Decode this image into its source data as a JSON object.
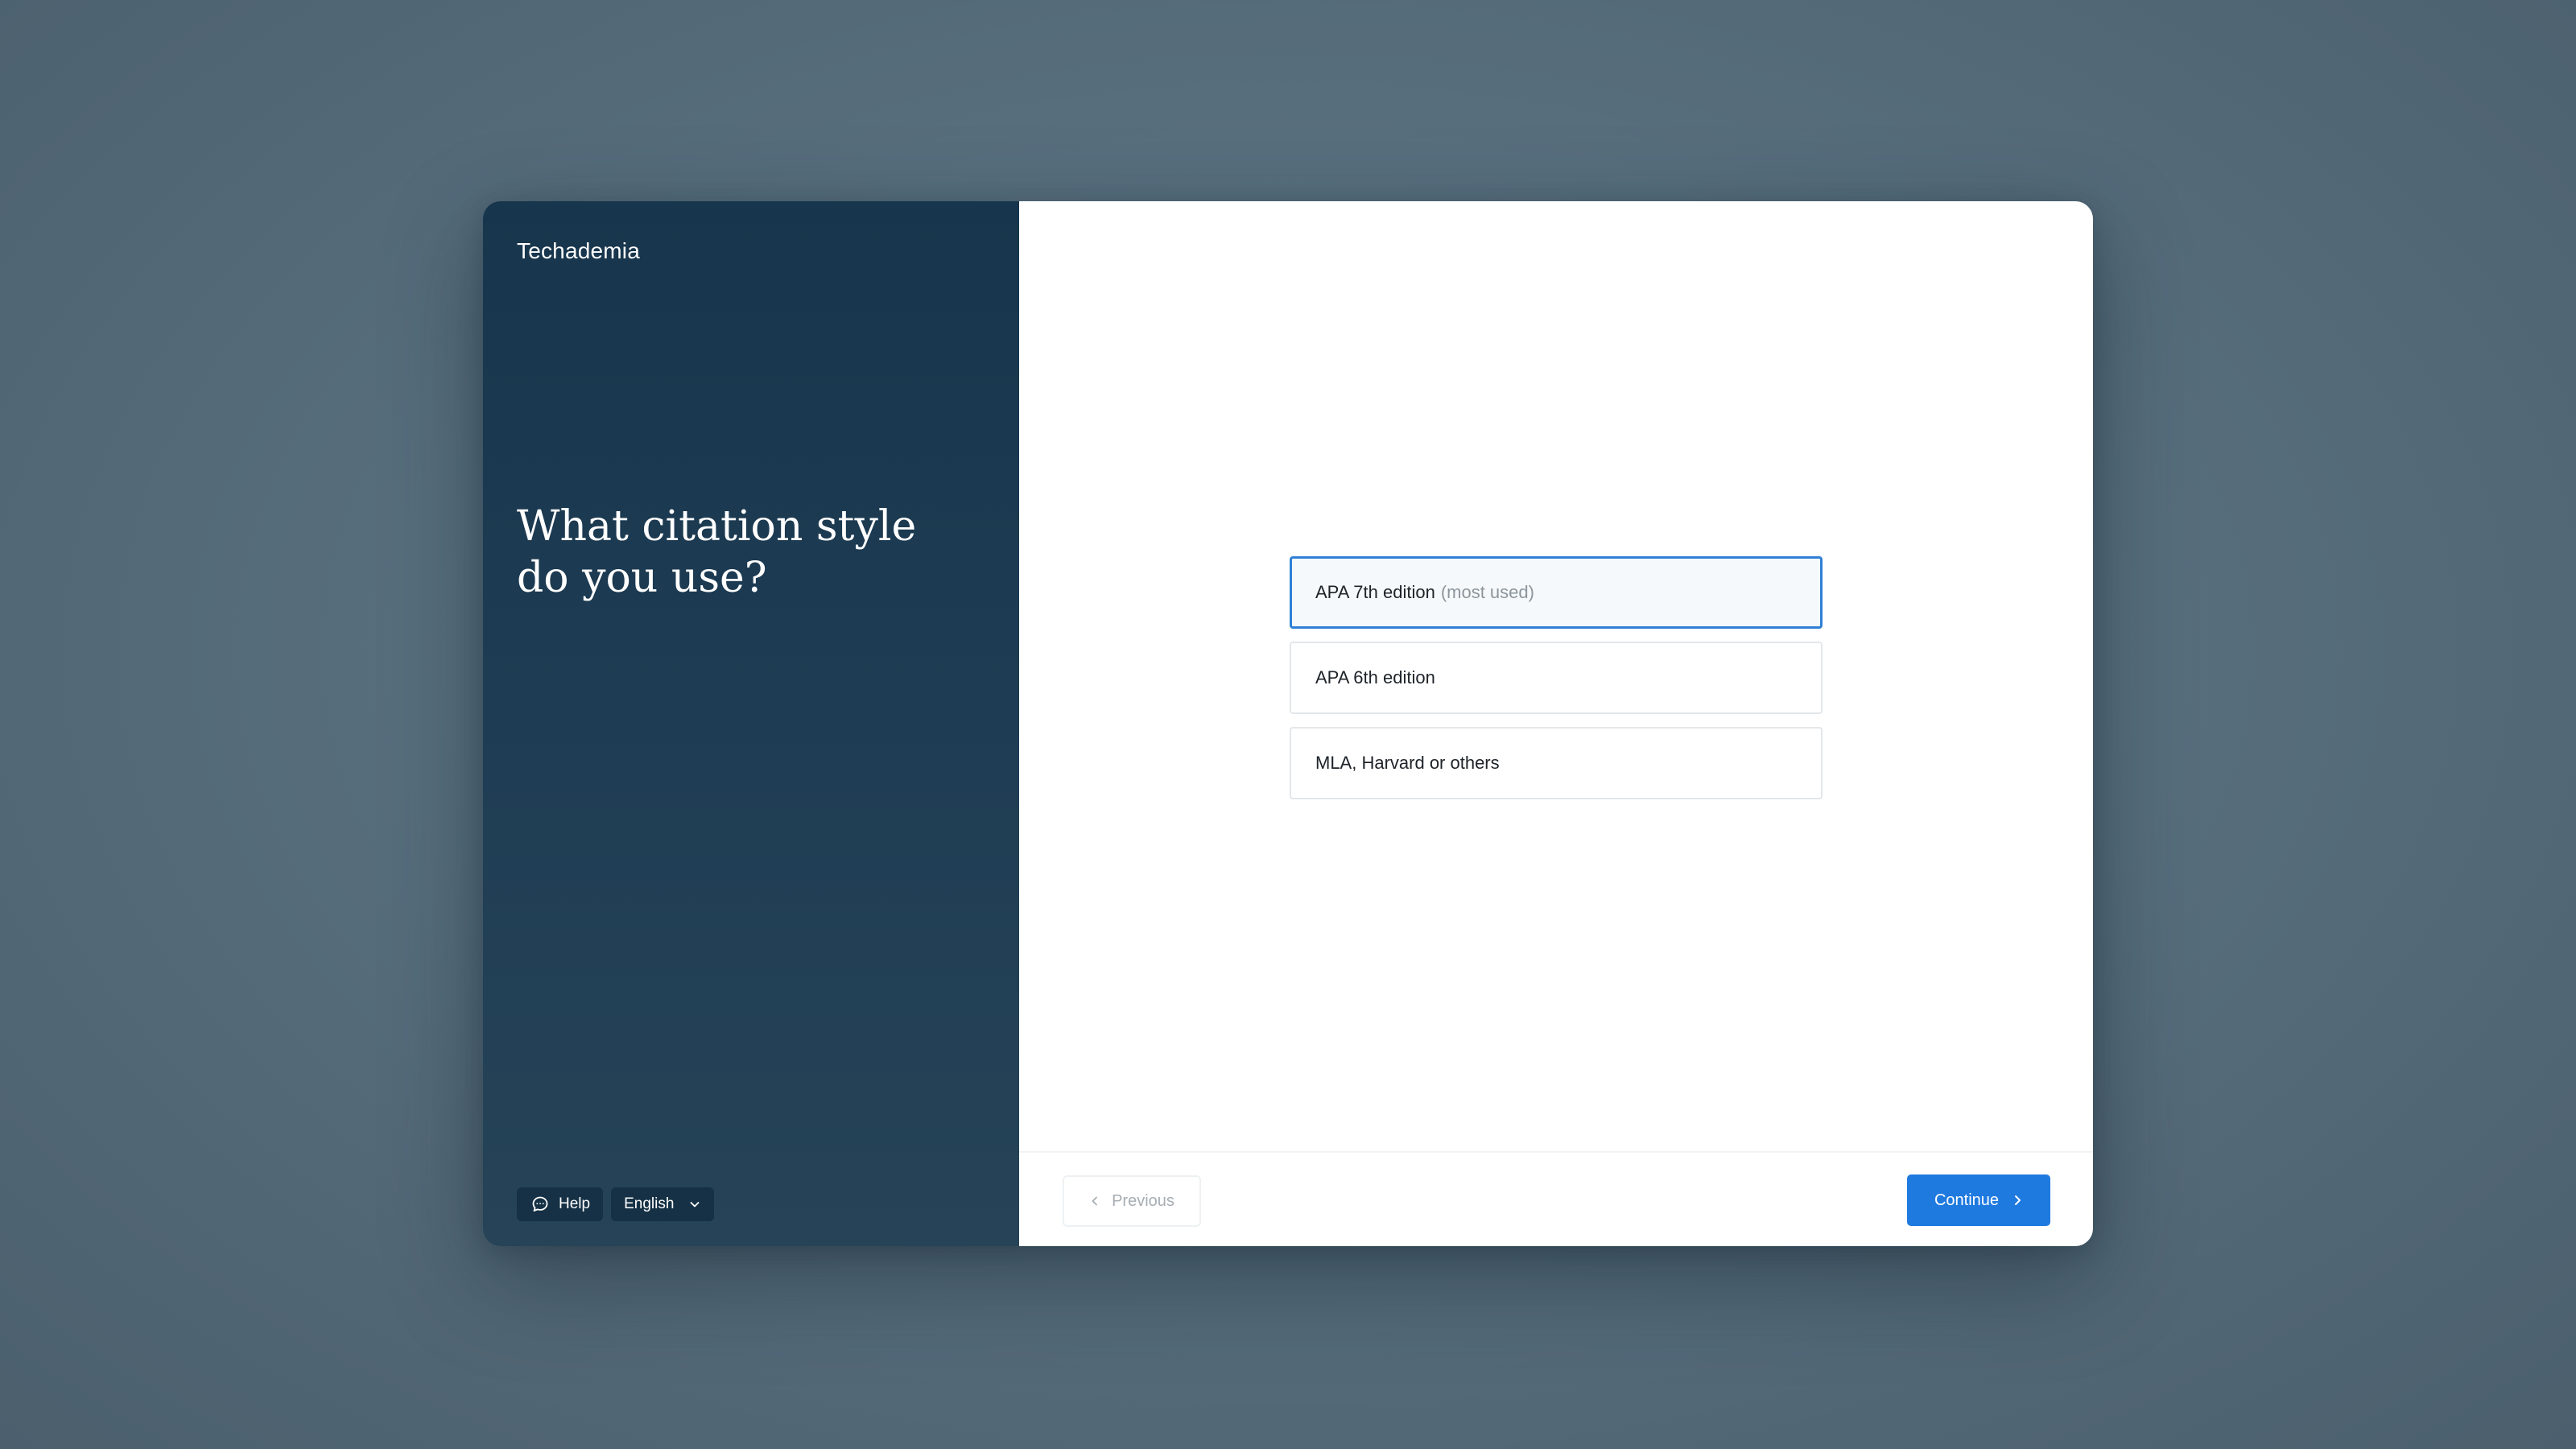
{
  "brand": {
    "name": "Techademia"
  },
  "question": {
    "heading": "What citation style do you use?"
  },
  "sidebar_controls": {
    "help_label": "Help",
    "help_icon": "chat-bubble-icon",
    "language_label": "English",
    "language_icon": "chevron-down-icon"
  },
  "options": [
    {
      "label": "APA 7th edition",
      "hint": "(most used)",
      "selected": true
    },
    {
      "label": "APA 6th edition",
      "hint": "",
      "selected": false
    },
    {
      "label": "MLA, Harvard or others",
      "hint": "",
      "selected": false
    }
  ],
  "footer": {
    "previous_label": "Previous",
    "previous_icon": "chevron-left-icon",
    "previous_disabled": true,
    "continue_label": "Continue",
    "continue_icon": "chevron-right-icon"
  },
  "colors": {
    "sidebar_bg": "#1b3a51",
    "accent": "#1f7ae0",
    "selected_border": "#2f80d6",
    "page_bg": "#5a7180"
  }
}
